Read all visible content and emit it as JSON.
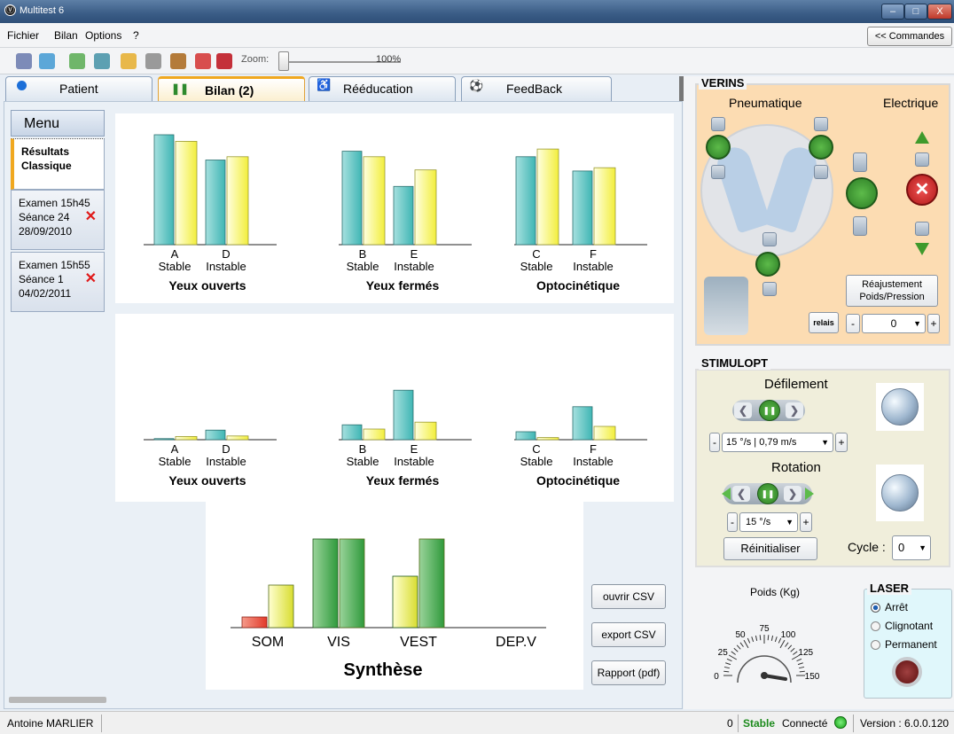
{
  "window": {
    "title": "Multitest 6",
    "logo_glyph": "Ⓥ",
    "min_glyph": "–",
    "max_glyph": "□",
    "close_glyph": "X"
  },
  "menubar": {
    "items": [
      "Fichier",
      "Bilan",
      "Options",
      "?"
    ],
    "commandes_label": "<< Commandes"
  },
  "toolbar": {
    "zoom_label": "Zoom:",
    "zoom_value": "100%",
    "zoom_level": 0.0
  },
  "tabs": [
    {
      "label": "Patient",
      "icon": "user-icon"
    },
    {
      "label": "Bilan (2)",
      "icon": "footprints-icon"
    },
    {
      "label": "Rééducation",
      "icon": "exercise-icon"
    },
    {
      "label": "FeedBack",
      "icon": "ball-icon"
    }
  ],
  "sidebar": {
    "menu_label": "Menu",
    "results_line1": "Résultats",
    "results_line2": "Classique",
    "exams": [
      {
        "line1": "Examen 15h45",
        "line2": "Séance 24",
        "line3": "28/09/2010"
      },
      {
        "line1": "Examen 15h55",
        "line2": "Séance 1",
        "line3": "04/02/2011"
      }
    ]
  },
  "charts": {
    "top": {
      "groups": [
        {
          "caption": "Yeux ouverts",
          "ticks": [
            [
              "A",
              "Stable"
            ],
            [
              "D",
              "Instable"
            ]
          ]
        },
        {
          "caption": "Yeux fermés",
          "ticks": [
            [
              "B",
              "Stable"
            ],
            [
              "E",
              "Instable"
            ]
          ]
        },
        {
          "caption": "Optocinétique",
          "ticks": [
            [
              "C",
              "Stable"
            ],
            [
              "F",
              "Instable"
            ]
          ]
        }
      ]
    },
    "middle": {
      "groups": [
        {
          "caption": "Yeux ouverts",
          "ticks": [
            [
              "A",
              "Stable"
            ],
            [
              "D",
              "Instable"
            ]
          ]
        },
        {
          "caption": "Yeux fermés",
          "ticks": [
            [
              "B",
              "Stable"
            ],
            [
              "E",
              "Instable"
            ]
          ]
        },
        {
          "caption": "Optocinétique",
          "ticks": [
            [
              "C",
              "Stable"
            ],
            [
              "F",
              "Instable"
            ]
          ]
        }
      ]
    },
    "synthese": {
      "title": "Synthèse",
      "categories": [
        "SOM",
        "VIS",
        "VEST",
        "DEP.V"
      ]
    }
  },
  "chart_data": [
    {
      "type": "bar",
      "categories": [
        "A Stable",
        "D Instable",
        "B Stable",
        "E Instable",
        "C Stable",
        "F Instable"
      ],
      "series": [
        {
          "values": [
            100,
            77,
            85,
            53,
            80,
            67
          ]
        },
        {
          "values": [
            94,
            80,
            80,
            68,
            87,
            70
          ]
        }
      ],
      "colors": [
        "#3fb6b4",
        "#f2ee3c"
      ],
      "ylim": [
        0,
        100
      ]
    },
    {
      "type": "bar",
      "categories": [
        "A Stable",
        "D Instable",
        "B Stable",
        "E Instable",
        "C Stable",
        "F Instable"
      ],
      "series": [
        {
          "values": [
            2,
            18,
            28,
            93,
            15,
            62
          ]
        },
        {
          "values": [
            6,
            7,
            20,
            33,
            4,
            25
          ]
        }
      ],
      "colors": [
        "#3fb6b4",
        "#f2ee3c"
      ],
      "ylim": [
        0,
        100
      ]
    },
    {
      "type": "bar",
      "title": "Synthèse",
      "categories": [
        "SOM",
        "VIS",
        "VEST",
        "DEP.V"
      ],
      "series": [
        {
          "values": [
            12,
            100,
            58,
            0
          ]
        },
        {
          "values": [
            48,
            100,
            100,
            0
          ]
        }
      ],
      "colors": [
        "#2f9a3c",
        "#e8e838"
      ],
      "ylim": [
        0,
        100
      ]
    }
  ],
  "buttons": {
    "open_csv": "ouvrir CSV",
    "export_csv": "export CSV",
    "report": "Rapport (pdf)"
  },
  "verins": {
    "legend": "VERINS",
    "pneumatique": "Pneumatique",
    "electrique": "Electrique",
    "relais": "relais",
    "readjust_line1": "Réajustement",
    "readjust_line2": "Poids/Pression",
    "value": "0",
    "minus": "-",
    "plus": "+"
  },
  "stimulopt": {
    "legend": "STIMULOPT",
    "defilement": "Défilement",
    "speed": "15 °/s | 0,79 m/s",
    "rotation": "Rotation",
    "rotation_speed": "15 °/s",
    "reset": "Réinitialiser",
    "cycle_label": "Cycle :",
    "cycle_value": "0",
    "minus": "-",
    "plus": "+"
  },
  "poids": {
    "label": "Poids (Kg)",
    "ticks": [
      "0",
      "25",
      "50",
      "75",
      "100",
      "125",
      "150"
    ],
    "value": 150
  },
  "laser": {
    "legend": "LASER",
    "options": [
      "Arrêt",
      "Clignotant",
      "Permanent"
    ],
    "selected": 0
  },
  "status": {
    "user": "Antoine MARLIER",
    "count": "0",
    "state": "Stable",
    "connection": "Connecté",
    "version": "Version : 6.0.0.120"
  },
  "colors": {
    "teal": "#3fb6b4",
    "yellow": "#f2ee3c",
    "green": "#2f9a3c",
    "red": "#e23a2a",
    "accent": "#f0a820"
  }
}
